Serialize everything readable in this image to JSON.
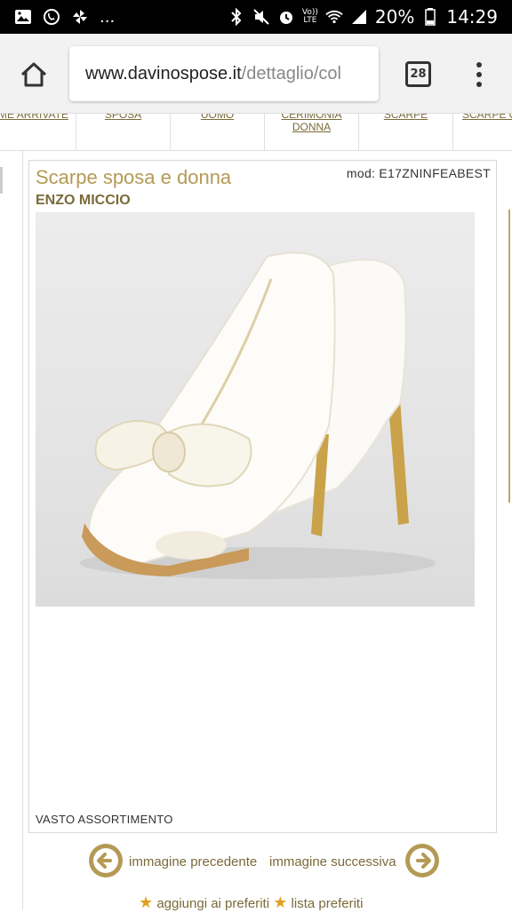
{
  "status_bar": {
    "left_extra": "...",
    "volte_top": "Vo))",
    "volte_bottom": "LTE",
    "battery": "20%",
    "time": "14:29"
  },
  "browser": {
    "url_host": "www.davinospose.it",
    "url_path": "/dettaglio/col",
    "tab_count": "28"
  },
  "site_nav": {
    "items": [
      {
        "label": "ME ARRIVATE"
      },
      {
        "label": "SPOSA"
      },
      {
        "label": "UOMO"
      },
      {
        "label": "CERIMONIA DONNA"
      },
      {
        "label": "SCARPE"
      },
      {
        "label": "SCARPE C"
      }
    ]
  },
  "product": {
    "title": "Scarpe sposa e donna",
    "model": "mod: E17ZNINFEABEST",
    "brand": "ENZO MICCIO",
    "description": "VASTO ASSORTIMENTO"
  },
  "pager": {
    "prev_label": "immagine precedente",
    "next_label": "immagine successiva"
  },
  "favorites": {
    "add_label": "aggiungi ai preferiti",
    "list_label": "lista preferiti"
  },
  "colors": {
    "gold": "#b59a55",
    "gold_dark": "#7a6a3a"
  }
}
